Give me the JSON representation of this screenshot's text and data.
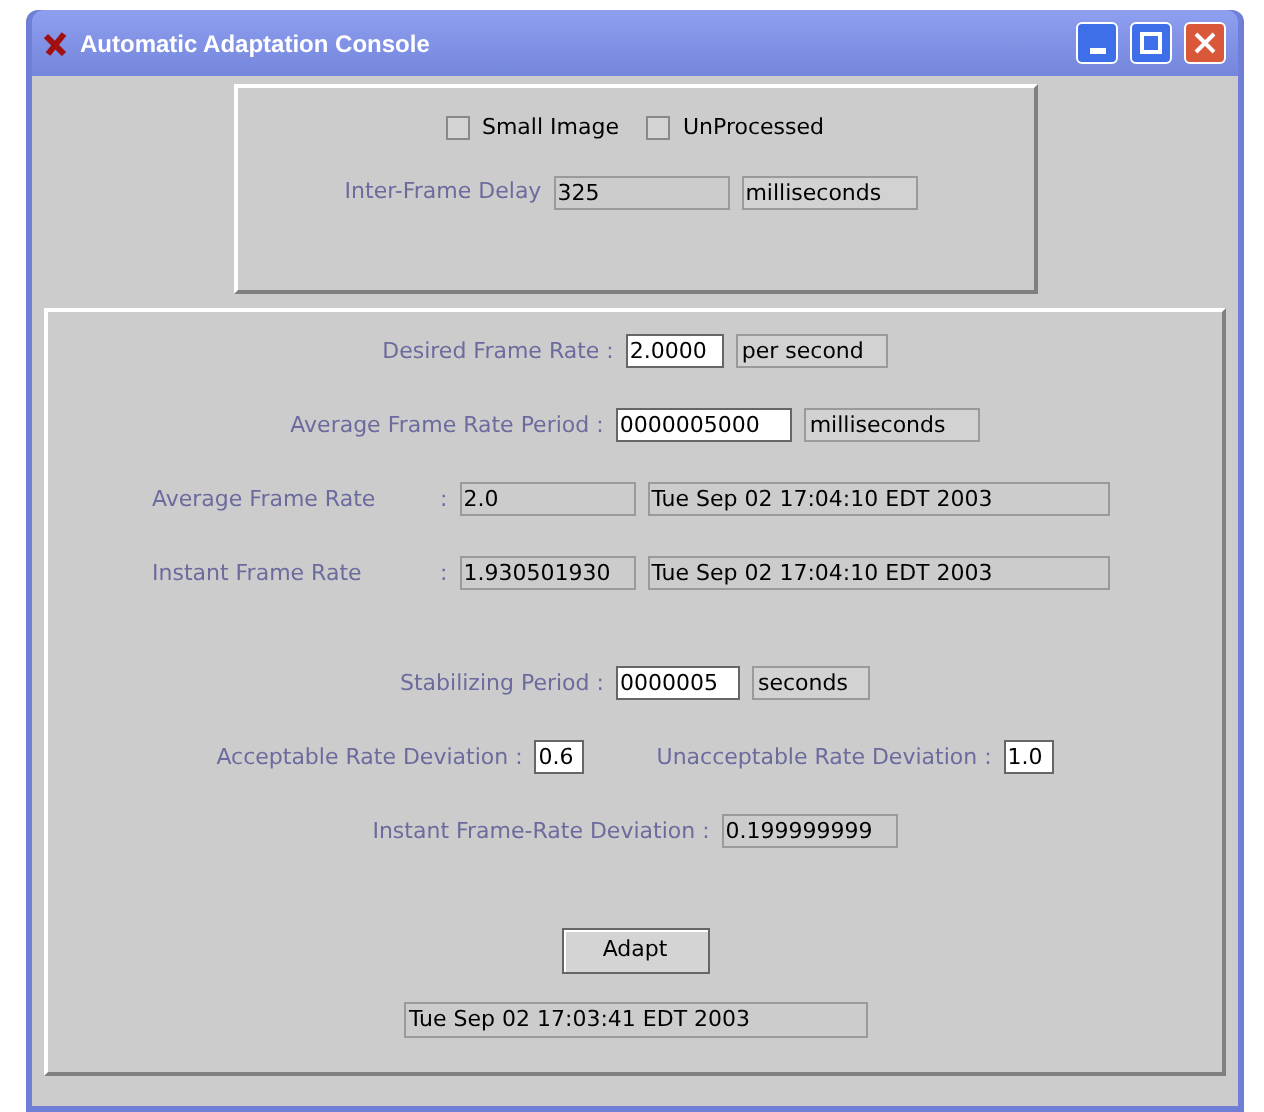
{
  "window": {
    "title": "Automatic Adaptation Console"
  },
  "top_panel": {
    "checkboxes": [
      {
        "label": "Small Image",
        "checked": false
      },
      {
        "label": "UnProcessed",
        "checked": false
      }
    ],
    "delay": {
      "label": "Inter-Frame Delay",
      "value": "325",
      "unit": "milliseconds"
    }
  },
  "rows": [
    {
      "items": [
        {
          "kind": "label",
          "text": "Desired Frame Rate :"
        },
        {
          "kind": "field",
          "text": "2.0000",
          "editable": true
        },
        {
          "kind": "unit",
          "text": "per second"
        }
      ]
    },
    {
      "items": [
        {
          "kind": "label",
          "text": "Average Frame Rate Period :"
        },
        {
          "kind": "field",
          "text": "0000005000",
          "editable": true
        },
        {
          "kind": "unit",
          "text": "milliseconds"
        }
      ]
    },
    {
      "items": [
        {
          "kind": "label",
          "text": "Average Frame Rate"
        },
        {
          "kind": "label",
          "text": ":"
        },
        {
          "kind": "field",
          "text": "2.0",
          "editable": false
        },
        {
          "kind": "field",
          "text": "Tue Sep 02 17:04:10 EDT 2003",
          "editable": false
        }
      ]
    },
    {
      "items": [
        {
          "kind": "label",
          "text": "Instant Frame Rate"
        },
        {
          "kind": "label",
          "text": ":"
        },
        {
          "kind": "field",
          "text": "1.930501930",
          "editable": false
        },
        {
          "kind": "field",
          "text": "Tue Sep 02 17:04:10 EDT 2003",
          "editable": false
        }
      ]
    },
    {
      "items": [
        {
          "kind": "label",
          "text": "Stabilizing Period :"
        },
        {
          "kind": "field",
          "text": "0000005",
          "editable": true
        },
        {
          "kind": "unit",
          "text": "seconds"
        }
      ]
    },
    {
      "items": [
        {
          "kind": "label",
          "text": "Acceptable Rate Deviation :"
        },
        {
          "kind": "field",
          "text": "0.6",
          "editable": true
        },
        {
          "kind": "label",
          "text": "Unacceptable Rate Deviation :"
        },
        {
          "kind": "field",
          "text": "1.0",
          "editable": true
        }
      ]
    },
    {
      "items": [
        {
          "kind": "label",
          "text": "Instant Frame-Rate Deviation :"
        },
        {
          "kind": "field",
          "text": "0.199999999",
          "editable": false
        }
      ]
    }
  ],
  "button": "Adapt",
  "status": "Tue Sep 02 17:03:41 EDT 2003"
}
